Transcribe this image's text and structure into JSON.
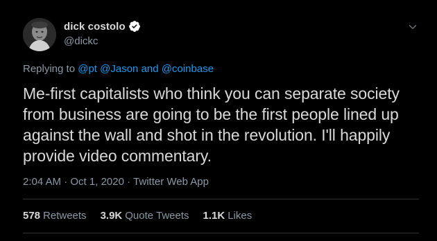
{
  "author": {
    "display_name": "dick costolo",
    "handle": "@dickc",
    "verified": true,
    "avatar": "avatar-photo"
  },
  "reply": {
    "prefix": "Replying to",
    "mentions": [
      "@pt",
      "@Jason",
      "and",
      "@coinbase"
    ]
  },
  "tweet": {
    "text": "Me-first capitalists who think you can separate society from business are going to be the first people lined up against the wall and shot in the revolution. I'll happily provide video commentary."
  },
  "meta": {
    "time": "2:04 AM",
    "separator": "·",
    "date": "Oct 1, 2020",
    "source": "Twitter Web App"
  },
  "stats": [
    {
      "value": "578",
      "label": "Retweets"
    },
    {
      "value": "3.9K",
      "label": "Quote Tweets"
    },
    {
      "value": "1.1K",
      "label": "Likes"
    }
  ],
  "icons": {
    "verified": "verified-badge-icon",
    "menu": "chevron-down-icon"
  },
  "colors": {
    "background": "#000000",
    "text": "#d9d9d9",
    "secondary": "#8b98a5",
    "link": "#1d9bf0",
    "divider": "#2f3336"
  }
}
